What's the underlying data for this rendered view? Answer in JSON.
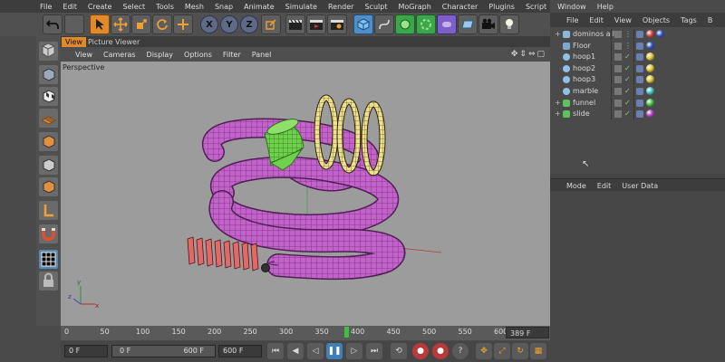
{
  "menubar": [
    "File",
    "Edit",
    "Create",
    "Select",
    "Tools",
    "Mesh",
    "Snap",
    "Animate",
    "Simulate",
    "Render",
    "Sculpt",
    "MoGraph",
    "Character",
    "Plugins",
    "Script",
    "Window",
    "Help"
  ],
  "toolbar": {
    "axis_x": "X",
    "axis_y": "Y",
    "axis_z": "Z"
  },
  "viewport": {
    "tabs": [
      "View",
      "Picture Viewer"
    ],
    "menu": [
      "View",
      "Cameras",
      "Display",
      "Options",
      "Filter",
      "Panel"
    ],
    "camera_label": "Perspective",
    "axis_labels": {
      "y": "y",
      "x": "x",
      "z": "z"
    }
  },
  "timeline": {
    "ticks": [
      "0",
      "50",
      "100",
      "150",
      "200",
      "250",
      "300",
      "350",
      "400",
      "450",
      "500",
      "550",
      "600"
    ],
    "current_frame_display": "389 F",
    "playhead_frame": 389
  },
  "transport": {
    "start_field": "0 F",
    "range_start": "0 F",
    "range_end": "600 F",
    "end_field": "600 F"
  },
  "object_manager": {
    "menu": [
      "File",
      "Edit",
      "View",
      "Objects",
      "Tags",
      "B"
    ],
    "objects": [
      {
        "name": "dominos all",
        "icon": "null-icon",
        "tags": [
          "#d04040",
          "#3050c0"
        ]
      },
      {
        "name": "Floor",
        "icon": "floor-icon",
        "tags": [
          "#3050c0"
        ]
      },
      {
        "name": "hoop1",
        "icon": "torus-icon",
        "tags": [
          "#e0c030"
        ]
      },
      {
        "name": "hoop2",
        "icon": "torus-icon",
        "tags": [
          "#e0c030"
        ]
      },
      {
        "name": "hoop3",
        "icon": "torus-icon",
        "tags": [
          "#e0c030"
        ]
      },
      {
        "name": "marble",
        "icon": "sphere-icon",
        "tags": [
          "#40c0c0"
        ]
      },
      {
        "name": "funnel",
        "icon": "lathe-icon",
        "tags": [
          "#40c040"
        ]
      },
      {
        "name": "slide",
        "icon": "sweep-icon",
        "tags": [
          "#b040c0"
        ]
      }
    ]
  },
  "attribute_manager": {
    "menu": [
      "Mode",
      "Edit",
      "User Data"
    ]
  }
}
